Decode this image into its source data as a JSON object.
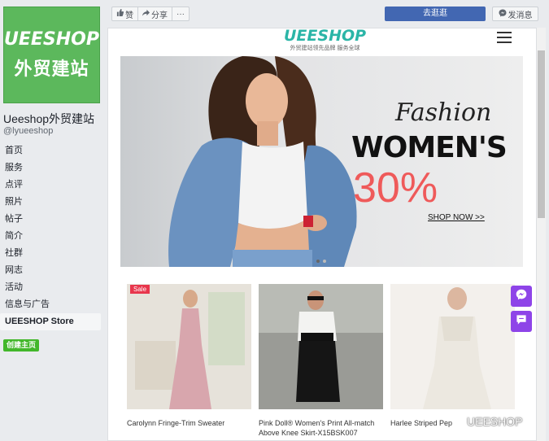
{
  "sidebar": {
    "logo_line1": "UEESHOP",
    "logo_line2": "外贸建站",
    "page_name": "Ueeshop外贸建站",
    "handle": "@lyueeshop",
    "items": [
      {
        "label": "首页"
      },
      {
        "label": "服务"
      },
      {
        "label": "点评"
      },
      {
        "label": "照片"
      },
      {
        "label": "帖子"
      },
      {
        "label": "简介"
      },
      {
        "label": "社群"
      },
      {
        "label": "网志"
      },
      {
        "label": "活动"
      },
      {
        "label": "信息与广告"
      },
      {
        "label": "UEESHOP Store"
      }
    ],
    "create_page": "创建主页"
  },
  "topbar": {
    "like": "赞",
    "share": "分享",
    "more": "···",
    "visit": "去逛逛",
    "message": "发消息"
  },
  "store": {
    "brand": "UEESHOP",
    "tagline": "外贸建站领先品牌 服务全球",
    "banner": {
      "script": "Fashion",
      "headline": "WOMEN'S",
      "discount": "30%",
      "cta": "SHOP NOW >>"
    },
    "products": [
      {
        "name": "Carolynn Fringe-Trim Sweater",
        "badge": "Sale"
      },
      {
        "name": "Pink Doll® Women's Print All-match Above Knee Skirt-X15BSK007",
        "badge": ""
      },
      {
        "name": "Harlee Striped Pep",
        "badge": ""
      }
    ]
  },
  "watermark": "UEESHOP",
  "colors": {
    "brand_green": "#5cb85c",
    "facebook_blue": "#4267b2",
    "accent_teal": "#2bb5a7",
    "discount_red": "#ef5a5a",
    "chat_purple": "#8e44e8"
  }
}
